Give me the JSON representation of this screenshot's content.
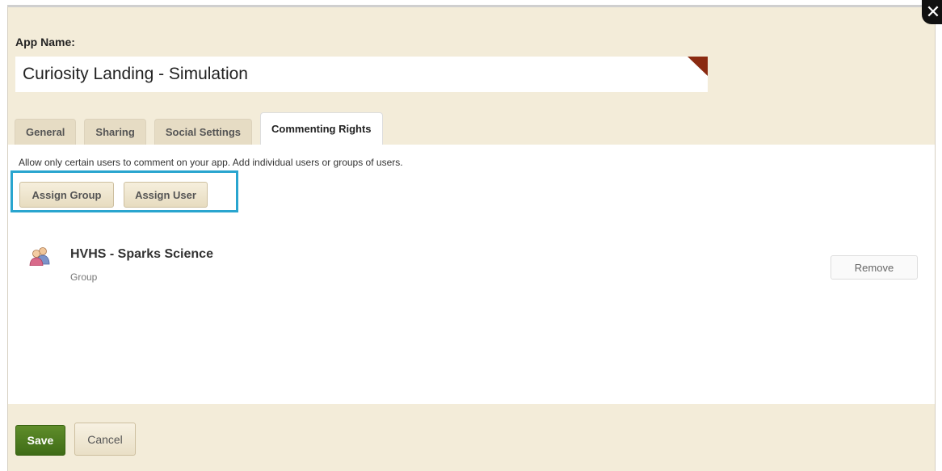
{
  "app_name": {
    "label": "App Name:",
    "value": "Curiosity Landing - Simulation"
  },
  "tabs": [
    {
      "label": "General",
      "active": false
    },
    {
      "label": "Sharing",
      "active": false
    },
    {
      "label": "Social Settings",
      "active": false
    },
    {
      "label": "Commenting Rights",
      "active": true
    }
  ],
  "commenting": {
    "description": "Allow only certain users to comment on your app. Add individual users or groups of users.",
    "assign_group_label": "Assign Group",
    "assign_user_label": "Assign User",
    "entries": [
      {
        "name": "HVHS - Sparks Science",
        "type": "Group",
        "icon": "group-icon",
        "remove_label": "Remove"
      }
    ]
  },
  "footer": {
    "save_label": "Save",
    "cancel_label": "Cancel"
  },
  "icons": {
    "close": "close-icon",
    "group": "group-icon"
  },
  "colors": {
    "highlight": "#29a5cf",
    "save_button": "#4a7a1f",
    "dialog_background": "#f3ecd9",
    "corner_marker": "#8a2a10"
  }
}
